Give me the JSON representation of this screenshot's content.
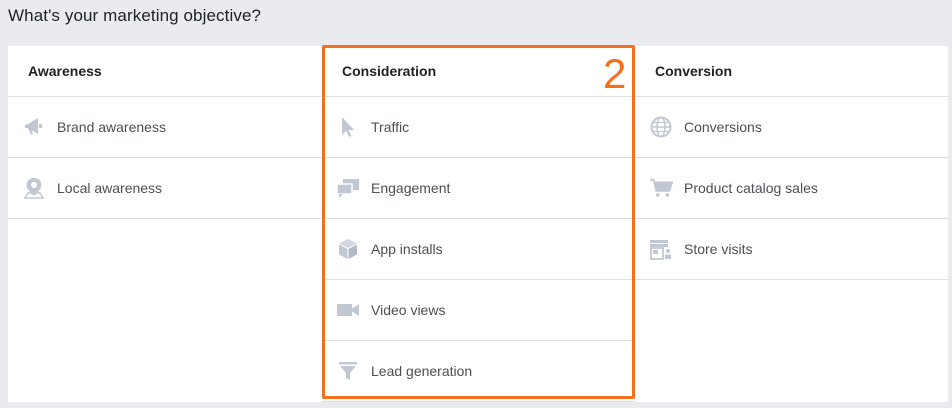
{
  "heading": "What's your marketing objective?",
  "highlight_number": "2",
  "colors": {
    "icon": "#c2c8d3",
    "highlight": "#f56f1c",
    "text": "#4b4f56"
  },
  "columns": [
    {
      "title": "Awareness",
      "items": [
        {
          "label": "Brand awareness",
          "icon": "megaphone-icon"
        },
        {
          "label": "Local awareness",
          "icon": "location-pin-icon"
        }
      ]
    },
    {
      "title": "Consideration",
      "items": [
        {
          "label": "Traffic",
          "icon": "cursor-icon"
        },
        {
          "label": "Engagement",
          "icon": "chat-bubbles-icon"
        },
        {
          "label": "App installs",
          "icon": "box-icon"
        },
        {
          "label": "Video views",
          "icon": "video-camera-icon"
        },
        {
          "label": "Lead generation",
          "icon": "funnel-icon"
        }
      ]
    },
    {
      "title": "Conversion",
      "items": [
        {
          "label": "Conversions",
          "icon": "globe-icon"
        },
        {
          "label": "Product catalog sales",
          "icon": "shopping-cart-icon"
        },
        {
          "label": "Store visits",
          "icon": "storefront-icon"
        }
      ]
    }
  ]
}
